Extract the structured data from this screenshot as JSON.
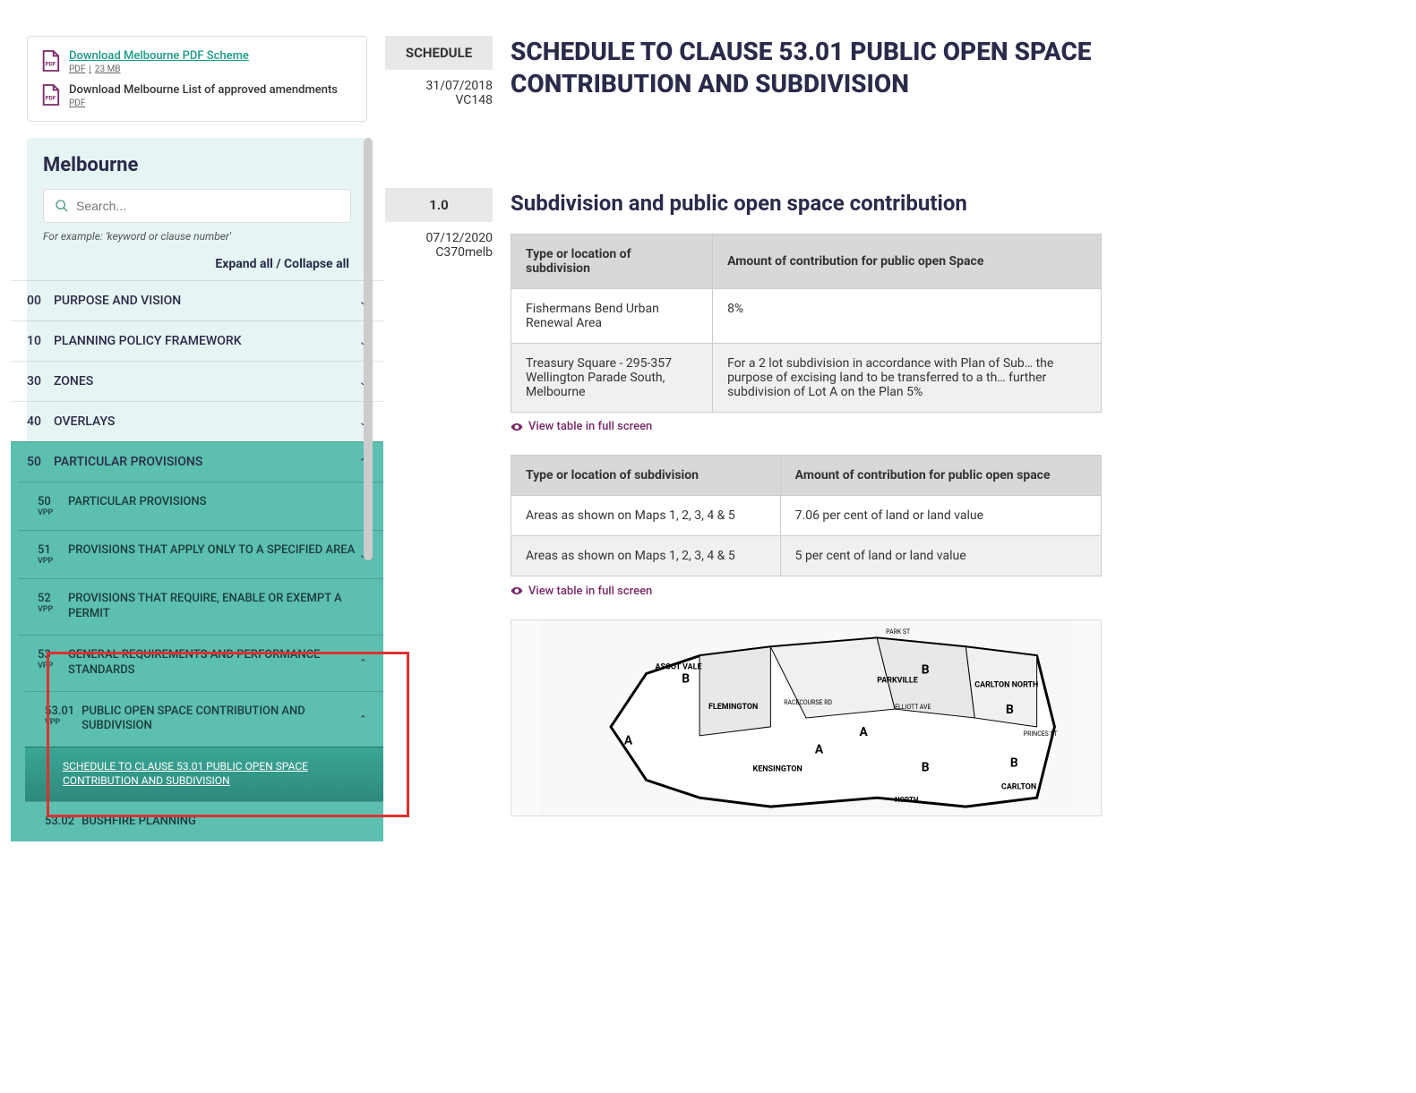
{
  "downloads": {
    "pdf_scheme": {
      "label": "Download Melbourne PDF Scheme",
      "type": "PDF",
      "size": "23 MB"
    },
    "amendments": {
      "label": "Download Melbourne List of approved amendments",
      "type": "PDF"
    }
  },
  "nav": {
    "title": "Melbourne",
    "search_placeholder": "Search...",
    "search_hint": "For example: 'keyword or clause number'",
    "expand": "Expand all",
    "collapse": "Collapse all",
    "items": [
      {
        "num": "00",
        "label": "PURPOSE AND VISION"
      },
      {
        "num": "10",
        "label": "PLANNING POLICY FRAMEWORK"
      },
      {
        "num": "30",
        "label": "ZONES"
      },
      {
        "num": "40",
        "label": "OVERLAYS"
      },
      {
        "num": "50",
        "label": "PARTICULAR PROVISIONS",
        "expanded": true
      }
    ],
    "sub50": [
      {
        "num": "50",
        "vpp": "VPP",
        "label": "PARTICULAR PROVISIONS"
      },
      {
        "num": "51",
        "vpp": "VPP",
        "label": "PROVISIONS THAT APPLY ONLY TO A SPECIFIED AREA"
      },
      {
        "num": "52",
        "vpp": "VPP",
        "label": "PROVISIONS THAT REQUIRE, ENABLE OR EXEMPT A PERMIT"
      },
      {
        "num": "53",
        "vpp": "VPP",
        "label": "GENERAL REQUIREMENTS AND PERFORMANCE STANDARDS"
      }
    ],
    "sub53": [
      {
        "num": "53.01",
        "vpp": "VPP",
        "label": "PUBLIC OPEN SPACE CONTRIBUTION AND SUBDIVISION"
      }
    ],
    "leaf": "SCHEDULE TO CLAUSE 53.01 PUBLIC OPEN SPACE CONTRIBUTION AND SUBDIVISION",
    "sub53b": {
      "num": "53.02",
      "label": "BUSHFIRE PLANNING"
    }
  },
  "meta": {
    "schedule": {
      "label": "SCHEDULE",
      "date": "31/07/2018",
      "code": "VC148"
    },
    "section": {
      "label": "1.0",
      "date": "07/12/2020",
      "code": "C370melb"
    }
  },
  "content": {
    "title": "SCHEDULE TO CLAUSE 53.01 PUBLIC OPEN SPACE CONTRIBUTION AND SUBDIVISION",
    "section_title": "Subdivision and public open space contribution",
    "table1": {
      "headers": [
        "Type or location of subdivision",
        "Amount of contribution for public open Space"
      ],
      "rows": [
        [
          "Fishermans Bend Urban Renewal Area",
          "8%"
        ],
        [
          "Treasury Square - 295-357 Wellington Parade South, Melbourne",
          "For a 2 lot subdivision in accordance with Plan of Sub… the purpose of excising land to be transferred to a th… further subdivision of Lot A on the Plan 5%"
        ]
      ]
    },
    "table2": {
      "headers": [
        "Type or location of subdivision",
        "Amount of contribution for public open space"
      ],
      "rows": [
        [
          "Areas as shown on Maps 1, 2, 3, 4 & 5",
          "7.06 per cent of land or land value"
        ],
        [
          "Areas as shown on Maps 1, 2, 3, 4 & 5",
          "5 per cent of land or land value"
        ]
      ]
    },
    "view_full": "View table in full screen"
  },
  "map_labels": [
    "ASCOT VALE",
    "FLEMINGTON",
    "KENSINGTON",
    "PARKVILLE",
    "CARLTON NORTH",
    "CARLTON",
    "NORTH",
    "PARK ST",
    "RACECOURSE RD",
    "ELLIOTT AVE",
    "PRINCES ST"
  ]
}
